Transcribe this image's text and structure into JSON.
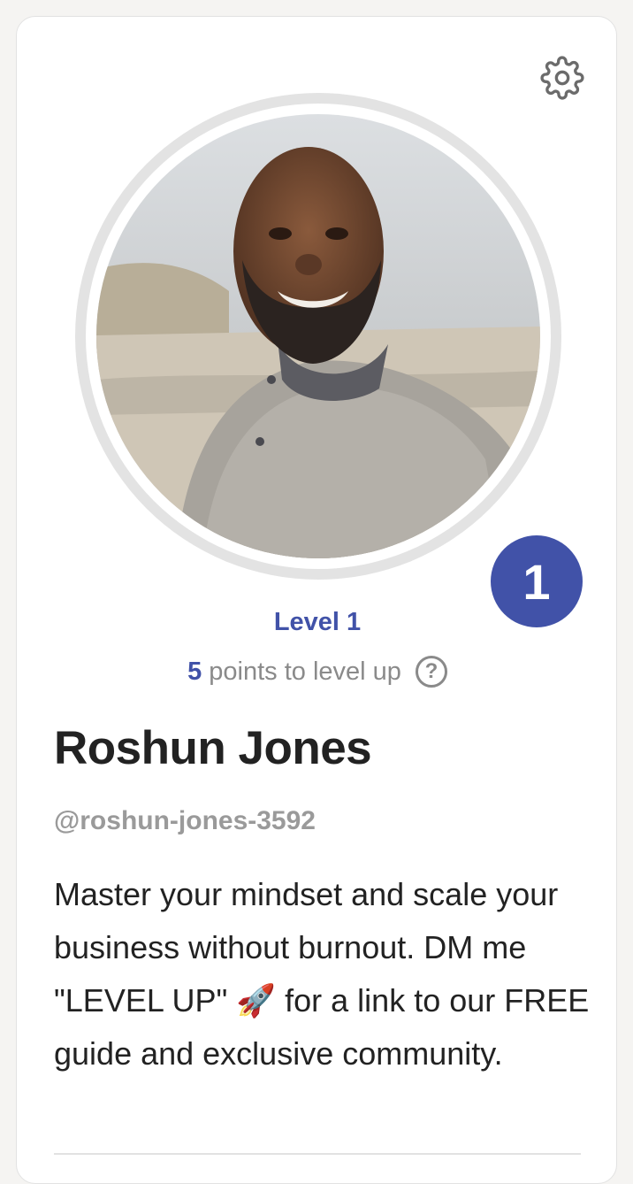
{
  "profile": {
    "level_badge": "1",
    "level_label": "Level 1",
    "points_to_level_up": "5",
    "points_suffix": "points to level up",
    "help_symbol": "?",
    "name": "Roshun Jones",
    "handle": "@roshun-jones-3592",
    "bio": "Master your mindset and scale your business without burnout. DM me \"LEVEL UP\" 🚀 for a link to our FREE guide and exclusive community."
  },
  "icons": {
    "settings": "gear-icon",
    "help": "question-circle-icon"
  },
  "colors": {
    "accent": "#4152a8",
    "muted_text": "#8a8a8a",
    "primary_text": "#222222",
    "ring": "#e3e3e3"
  }
}
